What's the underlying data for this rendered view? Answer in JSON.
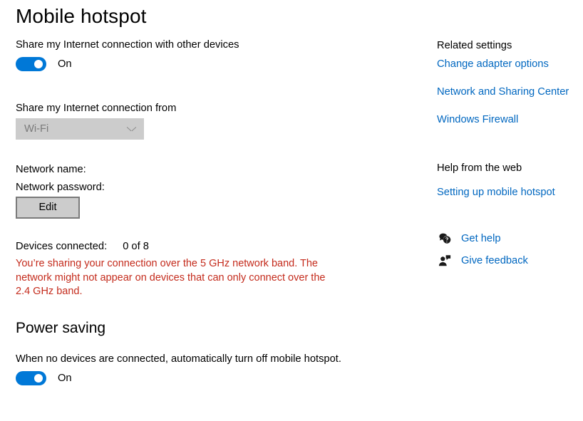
{
  "page": {
    "title": "Mobile hotspot"
  },
  "hotspot": {
    "share_label": "Share my Internet connection with other devices",
    "share_toggle_state": "On",
    "source_label": "Share my Internet connection from",
    "source_value": "Wi-Fi",
    "source_chevron_icon": "chevron-down-icon",
    "network_name_label": "Network name:",
    "network_name_value": "",
    "network_password_label": "Network password:",
    "network_password_value": "",
    "edit_button_label": "Edit",
    "devices_connected_label": "Devices connected:",
    "devices_connected_value": "0 of 8",
    "warning_text": "You’re sharing your connection over the 5 GHz network band. The network might not appear on devices that can only connect over the 2.4 GHz band.",
    "warning_color": "#c42b1c"
  },
  "power_saving": {
    "title": "Power saving",
    "description": "When no devices are connected, automatically turn off mobile hotspot.",
    "toggle_state": "On"
  },
  "related_settings": {
    "heading": "Related settings",
    "links": [
      {
        "label": "Change adapter options"
      },
      {
        "label": "Network and Sharing Center"
      },
      {
        "label": "Windows Firewall"
      }
    ]
  },
  "help_from_web": {
    "heading": "Help from the web",
    "links": [
      {
        "label": "Setting up mobile hotspot"
      }
    ]
  },
  "support": {
    "items": [
      {
        "label": "Get help",
        "icon": "question-speech-bubble-icon"
      },
      {
        "label": "Give feedback",
        "icon": "person-feedback-icon"
      }
    ]
  },
  "theme": {
    "accent": "#0078d7",
    "link": "#0067c0",
    "warning": "#c42b1c",
    "disabled_fill": "#cccccc"
  }
}
